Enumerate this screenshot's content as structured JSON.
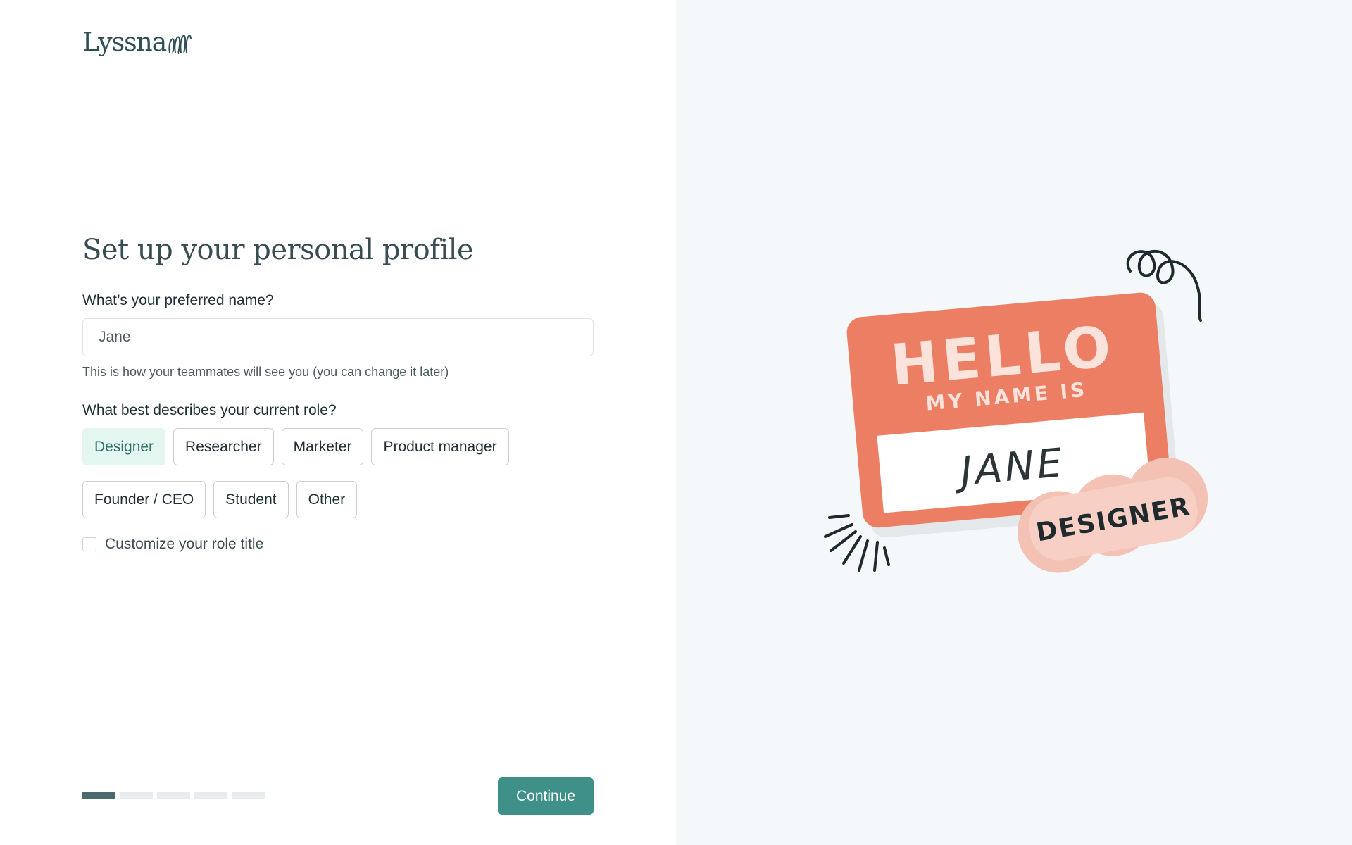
{
  "brand": {
    "name": "Lyssna"
  },
  "page": {
    "title": "Set up your personal profile"
  },
  "form": {
    "name_label": "What’s your preferred name?",
    "name_value": "Jane",
    "name_hint": "This is how your teammates will see you (you can change it later)",
    "role_label": "What best describes your current role?",
    "roles": [
      "Designer",
      "Researcher",
      "Marketer",
      "Product manager",
      "Founder / CEO",
      "Student",
      "Other"
    ],
    "selected_role": "Designer",
    "customize_label": "Customize your role title",
    "customize_checked": false
  },
  "progress": {
    "current_step": 1,
    "total_steps": 5
  },
  "actions": {
    "continue_label": "Continue"
  },
  "illustration": {
    "hello": "HELLO",
    "my_name_is": "MY NAME IS",
    "name": "JANE",
    "badge": "DESIGNER"
  },
  "colors": {
    "accent": "#3e9088",
    "selected_chip_bg": "#e3f6ef",
    "tag_orange": "#ec7e64",
    "badge_pink": "#f7cfc4",
    "right_panel_bg": "#f4f8fb"
  }
}
